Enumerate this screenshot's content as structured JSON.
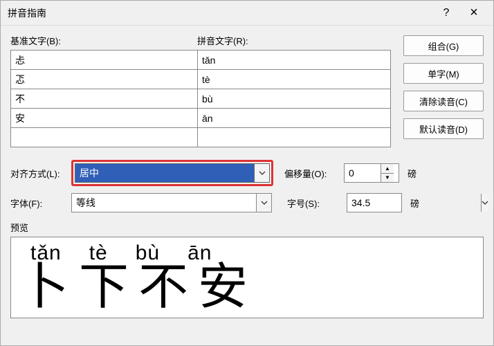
{
  "title": "拼音指南",
  "labels": {
    "base_text": "基准文字(B):",
    "ruby_text": "拼音文字(R):",
    "alignment": "对齐方式(L):",
    "font": "字体(F):",
    "offset": "偏移量(O):",
    "size": "字号(S):",
    "preview": "预览",
    "unit_pt": "磅"
  },
  "rows": [
    {
      "base": "忐",
      "ruby": "tǎn"
    },
    {
      "base": "忑",
      "ruby": "tè"
    },
    {
      "base": "不",
      "ruby": "bù"
    },
    {
      "base": "安",
      "ruby": "ān"
    },
    {
      "base": "",
      "ruby": ""
    }
  ],
  "buttons": {
    "group": "组合(G)",
    "single": "单字(M)",
    "clear_ruby": "清除读音(C)",
    "default_ruby": "默认读音(D)",
    "help": "?",
    "close": "×"
  },
  "form": {
    "alignment_value": "居中",
    "font_value": "等线",
    "offset_value": "0",
    "size_value": "34.5"
  },
  "preview": {
    "pinyin": [
      "tǎn",
      "tè",
      "bù",
      "ān"
    ],
    "hanzi": [
      "卜",
      "下",
      "不",
      "安"
    ]
  }
}
